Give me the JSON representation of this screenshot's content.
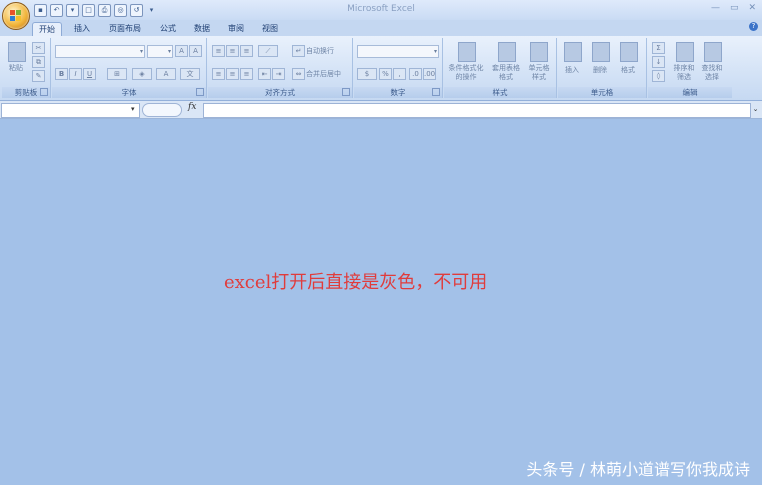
{
  "window": {
    "title": "Microsoft Excel",
    "controls": [
      "—",
      "▭",
      "✕"
    ]
  },
  "quick_access": {
    "icons": [
      "save-icon",
      "undo-icon",
      "redo-icon",
      "new-icon",
      "print-icon",
      "print-preview-icon",
      "spelling-icon",
      "customize-icon"
    ]
  },
  "tabs": [
    {
      "label": "开始",
      "active": true
    },
    {
      "label": "插入",
      "active": false
    },
    {
      "label": "页面布局",
      "active": false
    },
    {
      "label": "公式",
      "active": false
    },
    {
      "label": "数据",
      "active": false
    },
    {
      "label": "审阅",
      "active": false
    },
    {
      "label": "视图",
      "active": false
    }
  ],
  "ribbon": {
    "clipboard": {
      "label": "剪贴板",
      "paste": "粘贴"
    },
    "font": {
      "label": "字体",
      "bold": "B",
      "italic": "I",
      "underline": "U"
    },
    "alignment": {
      "label": "对齐方式",
      "wrap": "自动换行",
      "merge": "合并后居中"
    },
    "number": {
      "label": "数字",
      "percent": "%"
    },
    "styles": {
      "label": "样式",
      "conditional": "条件格式化",
      "conditional2": "的操作",
      "table": "套用表格",
      "table2": "格式",
      "cell_styles": "单元格",
      "cell_styles2": "样式"
    },
    "cells": {
      "label": "单元格",
      "insert": "插入",
      "delete": "删除",
      "format": "格式"
    },
    "editing": {
      "label": "编辑",
      "sort": "排序和",
      "sort2": "筛选",
      "find": "查找和",
      "find2": "选择",
      "sum": "Σ"
    }
  },
  "formula_bar": {
    "name_box_value": "",
    "fx": "fx",
    "formula_value": ""
  },
  "caption": "excel打开后直接是灰色，不可用",
  "watermark": "头条号 / 林萌小道谱写你我成诗"
}
